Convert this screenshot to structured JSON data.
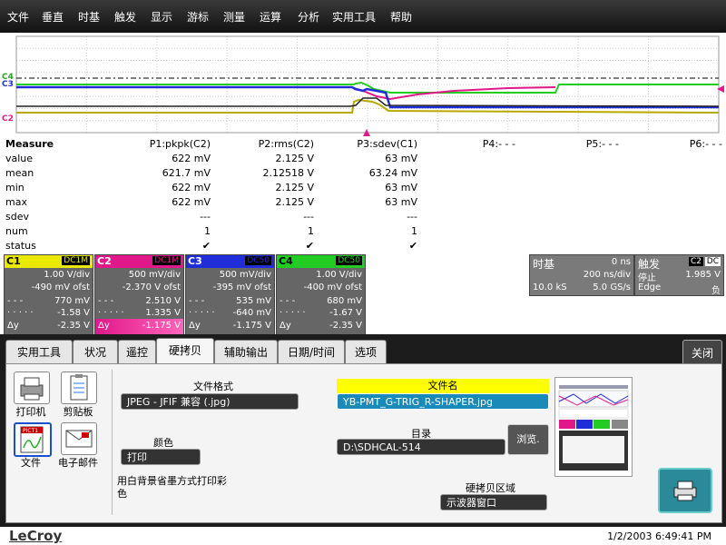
{
  "menu": [
    "文件",
    "垂直",
    "时基",
    "触发",
    "显示",
    "游标",
    "测量",
    "运算",
    "分析",
    "实用工具",
    "帮助"
  ],
  "markers": {
    "c4": "C4",
    "c3": "C3",
    "c2": "C2",
    "c2_bottom": "C2"
  },
  "measure": {
    "title": "Measure",
    "row_labels": [
      "value",
      "mean",
      "min",
      "max",
      "sdev",
      "num",
      "status"
    ],
    "params": [
      {
        "name": "P1:pkpk(C2)",
        "values": [
          "622 mV",
          "621.7 mV",
          "622 mV",
          "622 mV",
          "---",
          "1",
          "✔"
        ]
      },
      {
        "name": "P2:rms(C2)",
        "values": [
          "2.125 V",
          "2.12518 V",
          "2.125 V",
          "2.125 V",
          "---",
          "1",
          "✔"
        ]
      },
      {
        "name": "P3:sdev(C1)",
        "values": [
          "63 mV",
          "63.24 mV",
          "63 mV",
          "63 mV",
          "---",
          "1",
          "✔"
        ]
      },
      {
        "name": "P4:- - -"
      },
      {
        "name": "P5:- - -"
      },
      {
        "name": "P6:- - -"
      }
    ]
  },
  "channels": [
    {
      "id": "C1",
      "coupling": "DC1M",
      "vdiv": "1.00 V/div",
      "ofst": "-490 mV ofst",
      "c1": "770 mV",
      "c2": "-1.58 V",
      "dy": "-2.35 V",
      "color": "#e8e800"
    },
    {
      "id": "C2",
      "coupling": "DC1M",
      "vdiv": "500 mV/div",
      "ofst": "-2.370 V ofst",
      "c1": "2.510 V",
      "c2": "1.335 V",
      "dy": "-1.175 V",
      "color": "#e0188a"
    },
    {
      "id": "C3",
      "coupling": "DC50",
      "vdiv": "500 mV/div",
      "ofst": "-395 mV ofst",
      "c1": "535 mV",
      "c2": "-640 mV",
      "dy": "-1.175 V",
      "color": "#1f2ed8"
    },
    {
      "id": "C4",
      "coupling": "DC50",
      "vdiv": "1.00 V/div",
      "ofst": "-400 mV ofst",
      "c1": "680 mV",
      "c2": "-1.67 V",
      "dy": "-2.35 V",
      "color": "#22cc22"
    }
  ],
  "channel_row_labels": {
    "cur1": "- - -",
    "cur2": "· · · · ·",
    "dy": "Δy"
  },
  "timebase": {
    "label": "时基",
    "delay": "0 ns",
    "tdiv": "200 ns/div",
    "samples": "10.0 kS",
    "rate": "5.0 GS/s"
  },
  "trigger": {
    "label": "触发",
    "source": "C2",
    "coupling": "DC",
    "mode": "停止",
    "level": "1.985 V",
    "type": "Edge",
    "slope": "负"
  },
  "tabs": [
    "实用工具",
    "状况",
    "遥控",
    "硬拷贝",
    "辅助输出",
    "日期/时间",
    "选项"
  ],
  "active_tab": "硬拷贝",
  "close_label": "关闭",
  "dest": {
    "printer": "打印机",
    "clipboard": "剪贴板",
    "file": "文件",
    "email": "电子邮件",
    "file_icon_text": "PICT1"
  },
  "format_label": "文件格式",
  "format_value": "JPEG - JFIF 兼容 (.jpg)",
  "color_label": "颜色",
  "color_value": "打印",
  "color_note": "用白背景省墨方式打印彩色",
  "filename_label": "文件名",
  "filename_value": "YB-PMT_G-TRIG_R-SHAPER.jpg",
  "dir_label": "目录",
  "dir_value": "D:\\SDHCAL-514",
  "browse_label": "浏览.",
  "area_label": "硬拷贝区域",
  "area_value": "示波器窗口",
  "brand": "LeCroy",
  "datetime": "1/2/2003 6:49:41 PM"
}
